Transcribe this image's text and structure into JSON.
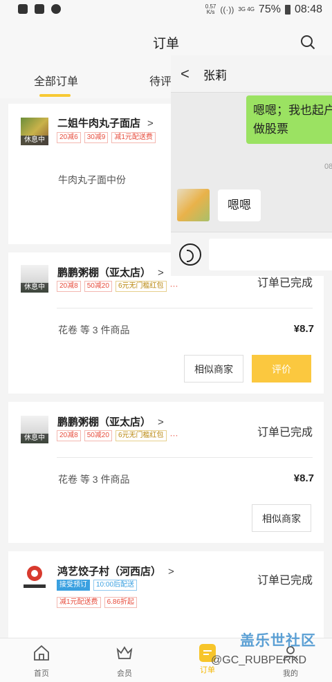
{
  "status_bar": {
    "net_speed_value": "0.57",
    "net_speed_unit": "K/s",
    "network": "3G 4G",
    "battery": "75%",
    "time": "08:48"
  },
  "header": {
    "title": "订单",
    "search_icon": "search-icon"
  },
  "tabs": [
    {
      "label": "全部订单",
      "active": true
    },
    {
      "label": "待评"
    }
  ],
  "orders": [
    {
      "shop": "二姐牛肉丸子面店",
      "rest_tag": "休息中",
      "promos": [
        "20减6",
        "30减9",
        "减1元配送费"
      ],
      "items": "牛肉丸子面中份"
    },
    {
      "shop": "鹏鹏粥棚（亚太店）",
      "rest_tag": "休息中",
      "promos": [
        "20减8",
        "50减20",
        "6元无门槛红包"
      ],
      "more": "···",
      "status": "订单已完成",
      "items": "花卷   等 3 件商品",
      "price": "¥8.7",
      "btn_similar": "相似商家",
      "btn_review": "评价"
    },
    {
      "shop": "鹏鹏粥棚（亚太店）",
      "rest_tag": "休息中",
      "promos": [
        "20减8",
        "50减20",
        "6元无门槛红包"
      ],
      "more": "···",
      "status": "订单已完成",
      "items": "花卷   等 3 件商品",
      "price": "¥8.7",
      "btn_similar": "相似商家"
    },
    {
      "shop": "鸿艺饺子村（河西店）",
      "tags": [
        "接受预订",
        "10:00后配送"
      ],
      "promos": [
        "减1元配送费",
        "6.86折起"
      ],
      "status": "订单已完成"
    }
  ],
  "chat": {
    "contact": "张莉",
    "outgoing": "嗯嗯；我也起户做股票",
    "time": "08",
    "incoming": "嗯嗯"
  },
  "bottom_nav": [
    {
      "label": "首页",
      "icon": "home-icon"
    },
    {
      "label": "会员",
      "icon": "crown-icon"
    },
    {
      "label": "订单",
      "icon": "order-icon",
      "active": true
    },
    {
      "label": "我的",
      "icon": "profile-icon"
    }
  ],
  "watermark": {
    "brand": "盖乐世社区",
    "user": "@GC_RUBPERKD"
  },
  "colors": {
    "accent": "#fbc83f",
    "promo_red": "#e74c3c",
    "chat_green": "#9be262"
  }
}
